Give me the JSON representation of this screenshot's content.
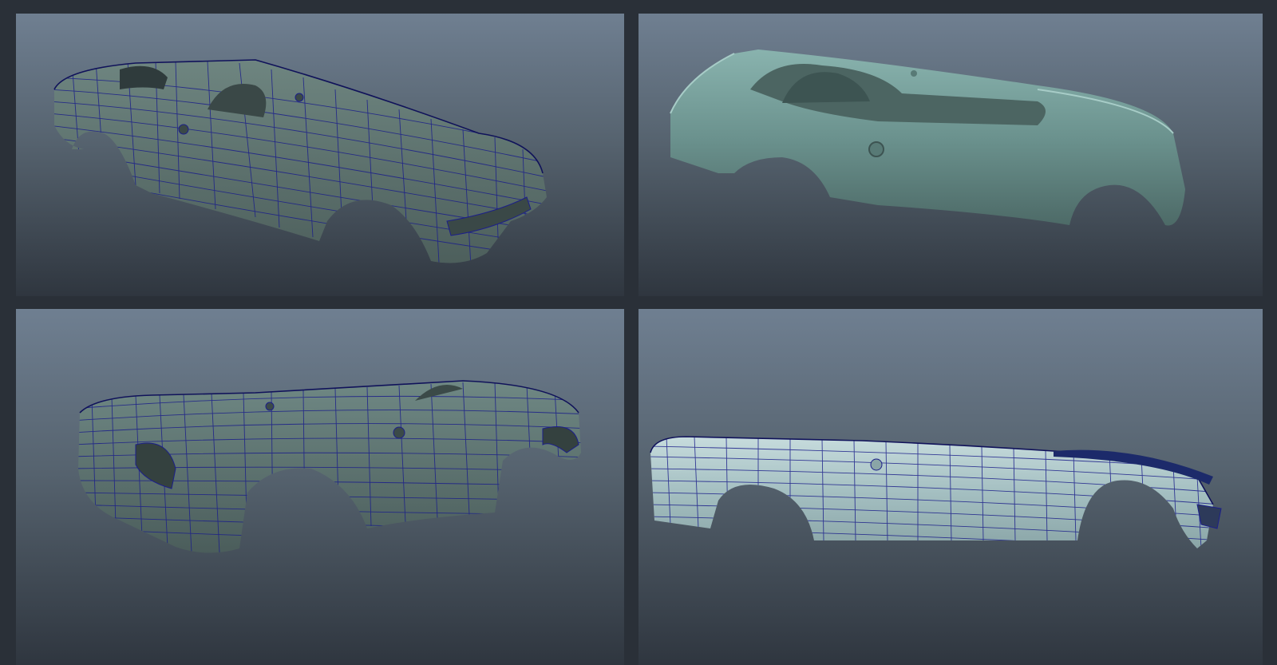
{
  "viewports": [
    {
      "id": "tl",
      "view": "front-three-quarter",
      "shading": "wireframe-on-shaded",
      "body_color": "#5e7470"
    },
    {
      "id": "tr",
      "view": "front-three-quarter",
      "shading": "smooth-shaded",
      "body_color": "#6f9a96"
    },
    {
      "id": "bl",
      "view": "rear-three-quarter",
      "shading": "wireframe-on-shaded",
      "body_color": "#5a6f6c"
    },
    {
      "id": "br",
      "view": "side",
      "shading": "wireframe-on-shaded",
      "body_color": "#a9c4c6"
    }
  ],
  "colors": {
    "background": "#2a3038",
    "viewport_top": "#6f7f91",
    "viewport_bottom": "#2f363f",
    "wireframe": "#1c1f8a"
  }
}
